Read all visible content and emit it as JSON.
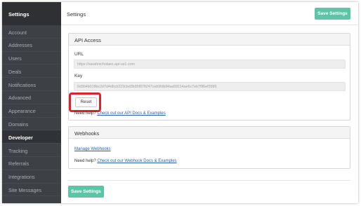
{
  "sidebar": {
    "title": "Settings",
    "items": [
      {
        "label": "Account"
      },
      {
        "label": "Addresses"
      },
      {
        "label": "Users"
      },
      {
        "label": "Deals"
      },
      {
        "label": "Notifications"
      },
      {
        "label": "Advanced"
      },
      {
        "label": "Appearance"
      },
      {
        "label": "Domains"
      },
      {
        "label": "Developer",
        "active": true
      },
      {
        "label": "Tracking"
      },
      {
        "label": "Referrals"
      },
      {
        "label": "Integrations"
      },
      {
        "label": "Site Messages"
      }
    ]
  },
  "header": {
    "title": "Settings",
    "save_label": "Save Settings"
  },
  "api_access": {
    "title": "API Access",
    "url_label": "URL",
    "url_value": "https://sarahnicholaex.api-us1.com",
    "key_label": "Key",
    "key_value": "6d3b4b018bc2d7d4dbcb223cbd3b95f878247ceb9fdb94aa58114ae6c7eb7f96ef3995",
    "reset_label": "Reset",
    "help_prefix": "Need help?",
    "help_link": "Check out our API Docs & Examples"
  },
  "webhooks": {
    "title": "Webhooks",
    "manage_link": "Manage Webhooks",
    "help_prefix": "Need help?",
    "help_link": "Check out our Webhook Docs & Examples"
  },
  "footer": {
    "save_label": "Save Settings"
  },
  "colors": {
    "sidebar_bg": "#3d4045",
    "accent_green": "#5bc5a5",
    "link_blue": "#2a5ea8",
    "highlight_red": "#d9252b"
  }
}
